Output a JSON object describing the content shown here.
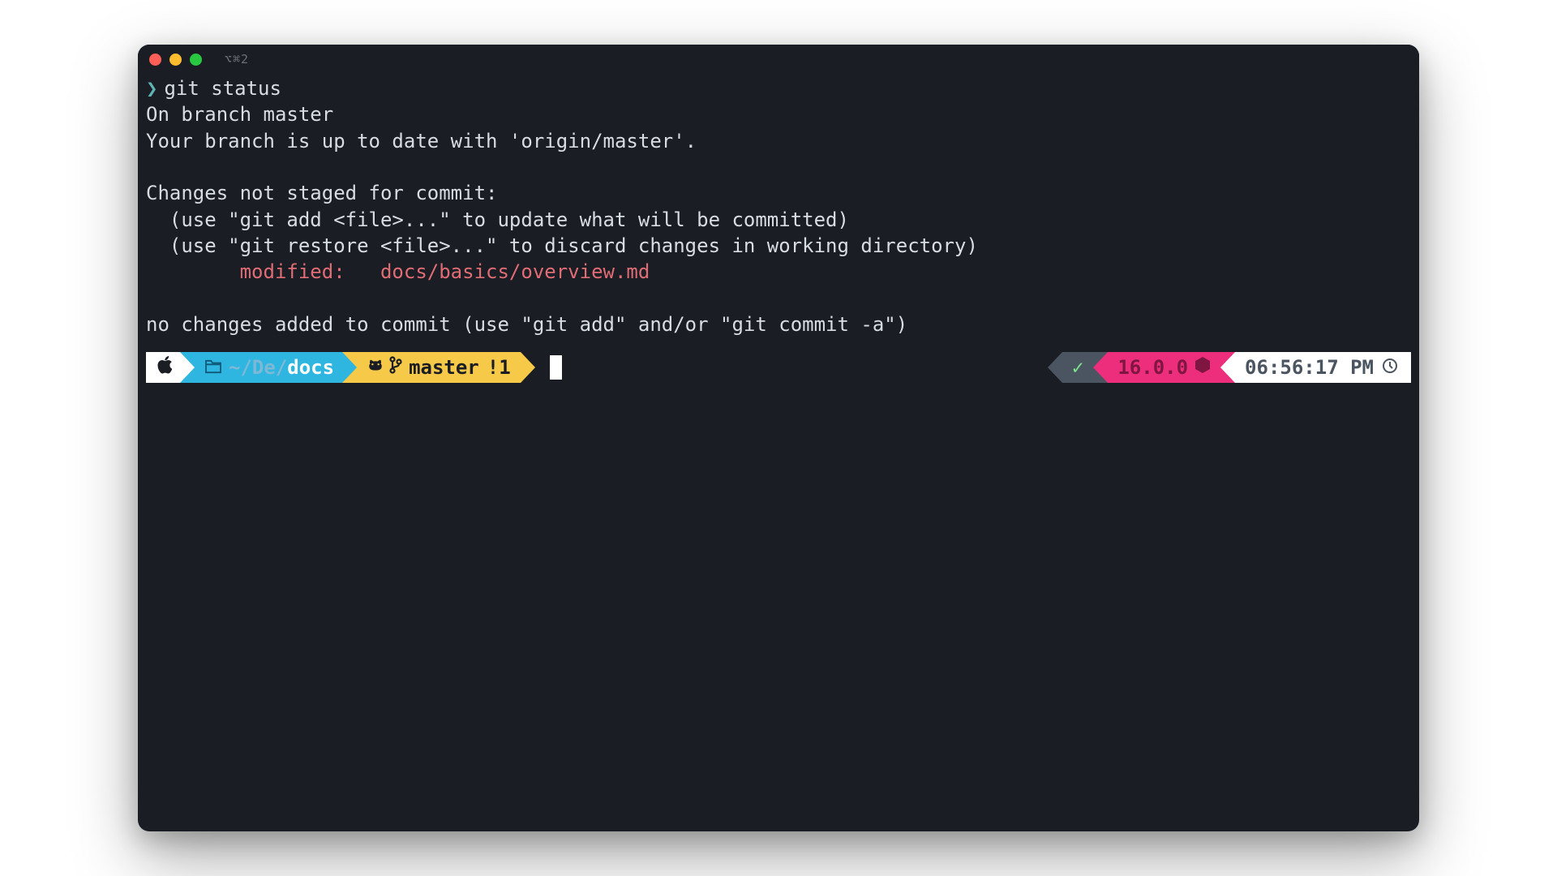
{
  "window": {
    "title": "⌥⌘2"
  },
  "session": {
    "prompt_symbol": "❯",
    "command": "git status",
    "output": {
      "branch_line": "On branch master",
      "upstream_line": "Your branch is up to date with 'origin/master'.",
      "changes_header": "Changes not staged for commit:",
      "hint_add": "  (use \"git add <file>...\" to update what will be committed)",
      "hint_restore": "  (use \"git restore <file>...\" to discard changes in working directory)",
      "modified_label": "        modified:   ",
      "modified_file": "docs/basics/overview.md",
      "footer": "no changes added to commit (use \"git add\" and/or \"git commit -a\")"
    }
  },
  "powerline": {
    "left": {
      "os_icon": "",
      "folder_icon": "🗀",
      "path_prefix": "~/",
      "path_mid": "De/",
      "path_dir": "docs",
      "git_icon": "",
      "branch_icon": "⎇",
      "branch_name": "master",
      "dirty": "!1"
    },
    "right": {
      "status_icon": "✓",
      "node_version": "16.0.0",
      "node_icon": "⬢",
      "time": "06:56:17 PM",
      "clock_icon": "◷"
    }
  },
  "colors": {
    "bg": "#1a1d23",
    "fg": "#d8dce3",
    "red": "#e06c75",
    "white": "#ffffff",
    "blue": "#2eb5e0",
    "yellow": "#f7c948",
    "pink": "#ed2e7c",
    "gray": "#4a5561"
  }
}
